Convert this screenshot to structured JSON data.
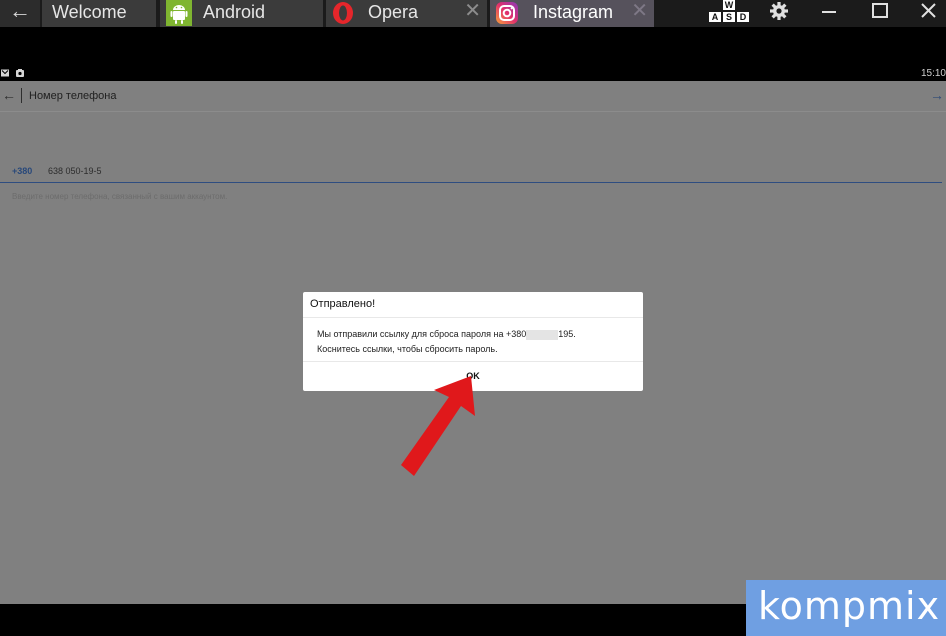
{
  "tabs": [
    {
      "label": "Welcome",
      "icon": "none"
    },
    {
      "label": "Android",
      "icon": "android-robot-icon"
    },
    {
      "label": "Opera",
      "icon": "opera-icon"
    },
    {
      "label": "Instagram",
      "icon": "instagram-icon",
      "active": true
    }
  ],
  "tab_close_glyph": "✕",
  "keymap": {
    "w": "W",
    "a": "A",
    "s": "S",
    "d": "D"
  },
  "status_bar": {
    "clock": "15:10"
  },
  "action_bar": {
    "title": "Номер телефона"
  },
  "phone": {
    "country_code": "+380",
    "value": "638 050-19-5",
    "helper": "Введите номер телефона, связанный с вашим аккаунтом."
  },
  "dialog": {
    "title": "Отправлено!",
    "line1_start": "Мы отправили ссылку для сброса пароля на +380",
    "line1_end": "195.",
    "line2": "Коснитесь ссылки, чтобы сбросить пароль.",
    "ok": "OK"
  },
  "watermark": {
    "text": "kompmix"
  },
  "colors": {
    "accent": "#2e4d80",
    "arrow": "#e0181b",
    "watermark": "#6f9fe2"
  }
}
